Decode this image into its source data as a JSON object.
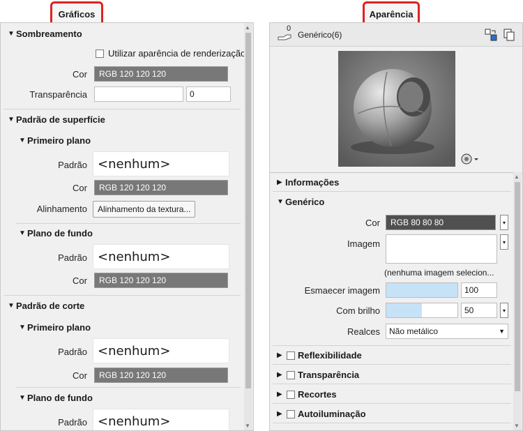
{
  "tabs": {
    "graficos": "Gráficos",
    "aparencia": "Aparência"
  },
  "left": {
    "sombreamento": {
      "title": "Sombreamento",
      "checkbox_label": "Utilizar aparência de renderização",
      "cor_label": "Cor",
      "cor_value": "RGB 120 120 120",
      "transparencia_label": "Transparência",
      "transparencia_value": "0"
    },
    "padrao_superficie": {
      "title": "Padrão de superfície",
      "primeiro_plano": {
        "title": "Primeiro plano",
        "padrao_label": "Padrão",
        "padrao_value": "<nenhum>",
        "cor_label": "Cor",
        "cor_value": "RGB 120 120 120",
        "alinhamento_label": "Alinhamento",
        "alinhamento_button": "Alinhamento da textura..."
      },
      "plano_fundo": {
        "title": "Plano de fundo",
        "padrao_label": "Padrão",
        "padrao_value": "<nenhum>",
        "cor_label": "Cor",
        "cor_value": "RGB 120 120 120"
      }
    },
    "padrao_corte": {
      "title": "Padrão de corte",
      "primeiro_plano": {
        "title": "Primeiro plano",
        "padrao_label": "Padrão",
        "padrao_value": "<nenhum>",
        "cor_label": "Cor",
        "cor_value": "RGB 120 120 120"
      },
      "plano_fundo": {
        "title": "Plano de fundo",
        "padrao_label": "Padrão",
        "padrao_value": "<nenhum>"
      }
    }
  },
  "right": {
    "header": {
      "count": "0",
      "asset_name": "Genérico(6)"
    },
    "informacoes": "Informações",
    "generico": {
      "title": "Genérico",
      "cor_label": "Cor",
      "cor_value": "RGB 80 80 80",
      "imagem_label": "Imagem",
      "imagem_none": "(nenhuma imagem selecion...",
      "esmaecer_label": "Esmaecer imagem",
      "esmaecer_value": "100",
      "brilho_label": "Com brilho",
      "brilho_value": "50",
      "brilho_fraction": 0.5,
      "realces_label": "Realces",
      "realces_value": "Não metálico"
    },
    "sections": [
      "Reflexibilidade",
      "Transparência",
      "Recortes",
      "Autoiluminação"
    ]
  },
  "colors": {
    "swatch_120": "#787878",
    "swatch_80": "#505050",
    "slider_fill": "#c6e2f7",
    "highlight": "#e02020"
  }
}
